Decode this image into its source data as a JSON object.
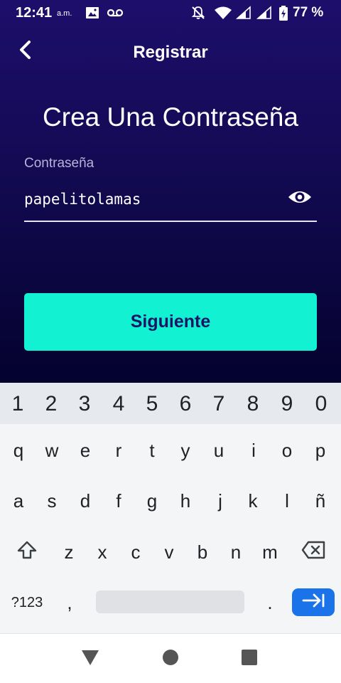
{
  "status_bar": {
    "time": "12:41",
    "ampm": "a.m.",
    "battery": "77 %",
    "icons": [
      "image-icon",
      "voicemail-icon",
      "notifications-off-icon",
      "wifi-icon",
      "signal-icon",
      "signal-icon",
      "battery-charging-icon"
    ]
  },
  "header": {
    "back_icon": "chevron-left-icon",
    "title": "Registrar"
  },
  "main": {
    "title": "Crea Una Contraseña",
    "password_label": "Contraseña",
    "password_value": "papelitolamas",
    "visibility_icon": "eye-icon",
    "next_button": "Siguiente"
  },
  "keyboard": {
    "number_row": [
      "1",
      "2",
      "3",
      "4",
      "5",
      "6",
      "7",
      "8",
      "9",
      "0"
    ],
    "row1": [
      "q",
      "w",
      "e",
      "r",
      "t",
      "y",
      "u",
      "i",
      "o",
      "p"
    ],
    "row2": [
      "a",
      "s",
      "d",
      "f",
      "g",
      "h",
      "j",
      "k",
      "l",
      "ñ"
    ],
    "row3": [
      "z",
      "x",
      "c",
      "v",
      "b",
      "n",
      "m"
    ],
    "symbols_key": "?123",
    "comma_key": ",",
    "period_key": ".",
    "shift_icon": "shift-icon",
    "backspace_icon": "backspace-icon",
    "enter_icon": "tab-arrow-icon"
  },
  "nav_bar": {
    "icons": [
      "back-triangle-icon",
      "home-circle-icon",
      "recents-square-icon"
    ]
  },
  "colors": {
    "accent": "#12f2d2",
    "background_top": "#1d0e6b",
    "background_bottom": "#04022e",
    "button_text": "#1b1566",
    "enter_key": "#1a73e8"
  }
}
